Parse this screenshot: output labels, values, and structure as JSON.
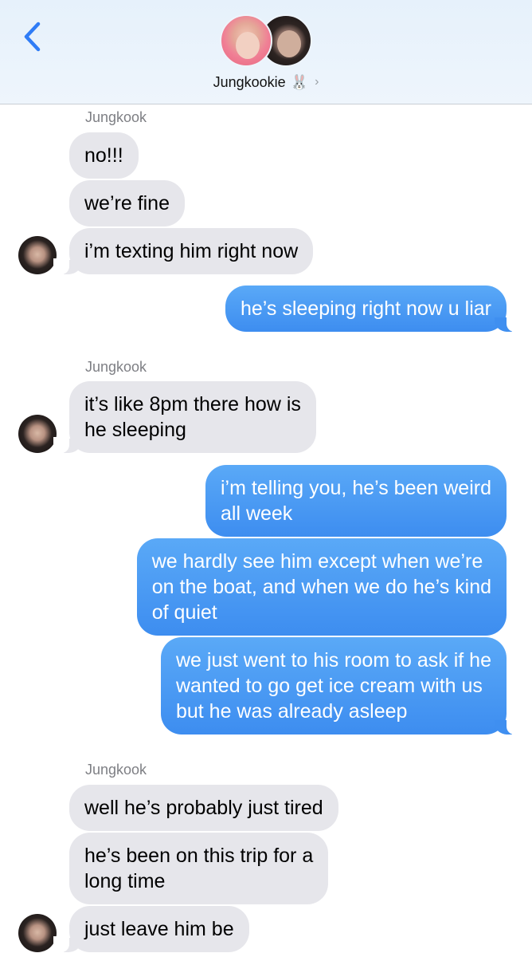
{
  "header": {
    "contact_name": "Jungkookie",
    "contact_emoji": "🐰",
    "chevron": "›"
  },
  "sender_label": "Jungkook",
  "messages": [
    {
      "id": "m1",
      "from": "them",
      "text": "no!!!"
    },
    {
      "id": "m2",
      "from": "them",
      "text": "we’re fine"
    },
    {
      "id": "m3",
      "from": "them",
      "text": "i’m texting him right now"
    },
    {
      "id": "m4",
      "from": "me",
      "text": "he’s sleeping right now u liar"
    },
    {
      "id": "m5",
      "from": "them",
      "text": "it’s like 8pm there how is\nhe sleeping"
    },
    {
      "id": "m6",
      "from": "me",
      "text": "i’m telling you, he’s been weird\nall week"
    },
    {
      "id": "m7",
      "from": "me",
      "text": "we hardly see him except when we’re\non the boat, and when we do he’s kind\nof quiet"
    },
    {
      "id": "m8",
      "from": "me",
      "text": "we just went to his room to ask if he\nwanted to go get ice cream with us\nbut he was already asleep"
    },
    {
      "id": "m9",
      "from": "them",
      "text": "well he’s probably just tired"
    },
    {
      "id": "m10",
      "from": "them",
      "text": "he’s been on this trip for a\nlong time"
    },
    {
      "id": "m11",
      "from": "them",
      "text": "just leave him be"
    }
  ],
  "colors": {
    "sent_bubble": "#3d8df0",
    "received_bubble": "#e6e6eb",
    "back_arrow": "#2f7cf6",
    "sender_label": "#7e7f84"
  },
  "icons": [
    "back-arrow-icon",
    "chevron-right-icon"
  ]
}
